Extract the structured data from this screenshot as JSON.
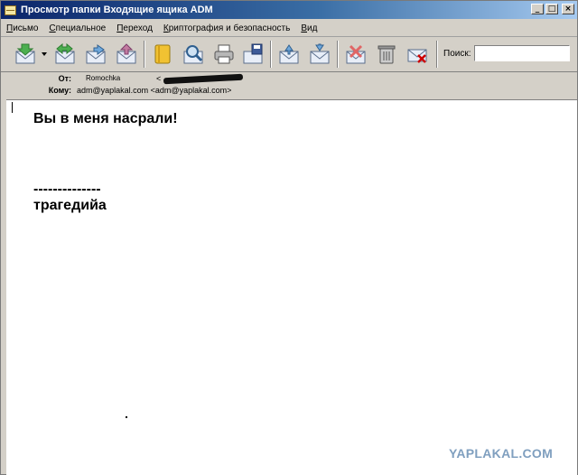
{
  "window": {
    "title": "Просмотр папки Входящие ящика ADM",
    "buttons": {
      "minimize": "_",
      "maximize": "□",
      "close": "×"
    }
  },
  "menu": {
    "items": [
      {
        "underline": "П",
        "rest": "исьмо"
      },
      {
        "underline": "С",
        "rest": "пециальное"
      },
      {
        "underline": "П",
        "rest": "ереход"
      },
      {
        "underline": "К",
        "rest": "риптография и безопасность"
      },
      {
        "underline": "В",
        "rest": "ид"
      }
    ]
  },
  "toolbar": {
    "icons": [
      "get-mail-icon",
      "mail-options-dropdown-icon",
      "forward-mail-icon",
      "open-mail-icon",
      "reply-mail-icon",
      "address-book-icon",
      "find-icon",
      "print-icon",
      "save-icon",
      "move-mail-icon",
      "copy-mail-icon",
      "mark-delete-icon",
      "trash-icon",
      "delete-mail-icon"
    ],
    "search_label": "Поиск:",
    "search_value": ""
  },
  "header": {
    "from_label": "От:",
    "from_name": "Romochka",
    "from_email_start": "<",
    "to_label": "Кому:",
    "to_value": "adm@yaplakal.com <adm@yaplakal.com>"
  },
  "message": {
    "line1": "Вы в меня насрали!",
    "line2": "--------------",
    "line3": "трагедийа"
  },
  "watermark": "YAPLAKAL.COM",
  "colors": {
    "titlebar_start": "#0a246a",
    "titlebar_end": "#a6caf0",
    "chrome": "#d4d0c8",
    "watermark": "#7f9fbf"
  }
}
